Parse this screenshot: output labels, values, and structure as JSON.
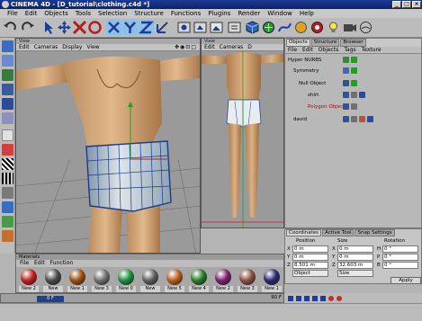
{
  "window": {
    "title": "CINEMA 4D - [D_tutorial\\clothing.c4d *]",
    "controls": [
      "_",
      "□",
      "×"
    ]
  },
  "menubar": [
    "File",
    "Edit",
    "Objects",
    "Tools",
    "Selection",
    "Structure",
    "Functions",
    "Plugins",
    "Render",
    "Window",
    "Help"
  ],
  "toolbar": {
    "icons": [
      "undo-icon",
      "redo-icon",
      "select-icon",
      "move-icon",
      "scale-icon",
      "rotate-icon",
      "x-axis-icon",
      "y-axis-icon",
      "z-axis-icon",
      "world-icon",
      "render-view-icon",
      "render-picture-icon",
      "cube-icon",
      "nurbs-icon",
      "deformer-icon",
      "scene-icon",
      "light-icon"
    ]
  },
  "viewports": [
    {
      "header": "View",
      "menu": [
        "Edit",
        "Cameras",
        "Display",
        "View"
      ]
    },
    {
      "header": "View",
      "menu": [
        "Edit",
        "Cameras",
        "D"
      ]
    }
  ],
  "object_manager": {
    "tabs": [
      "Objects",
      "Structure",
      "Browser"
    ],
    "active_tab": "Objects",
    "menu": [
      "File",
      "Edit",
      "Objects",
      "Tags",
      "Texture"
    ],
    "rows": [
      {
        "name": "Hyper NURBS",
        "color": "#000000"
      },
      {
        "name": "Symmetry",
        "color": "#000000"
      },
      {
        "name": "Null Object",
        "color": "#000000"
      },
      {
        "name": "shirt",
        "color": "#000000"
      },
      {
        "name": "Polygon Object",
        "color": "#c00000"
      },
      {
        "name": "david",
        "color": "#000000"
      }
    ]
  },
  "attributes": {
    "tabs": [
      "Coordinates",
      "Active Tool",
      "Snap Settings"
    ],
    "active_tab": "Coordinates",
    "columns": [
      "Position",
      "Size",
      "Rotation"
    ],
    "rows": [
      {
        "axis": "X",
        "pos": "0 m",
        "size_axis": "X",
        "size": "0 m",
        "rot_axis": "H",
        "rot": "0 °"
      },
      {
        "axis": "Y",
        "pos": "0 m",
        "size_axis": "Y",
        "size": "0 m",
        "rot_axis": "P",
        "rot": "0 °"
      },
      {
        "axis": "Z",
        "pos": "8.501 m",
        "size_axis": "Z",
        "size": "32.603 m",
        "rot_axis": "B",
        "rot": "0 °"
      }
    ],
    "mode_left": "Object",
    "mode_right": "Size",
    "apply_label": "Apply"
  },
  "material_manager": {
    "header": "Materials",
    "menu": [
      "File",
      "Edit",
      "Function"
    ],
    "materials": [
      {
        "name": "New 2",
        "color": "#c02020"
      },
      {
        "name": "New",
        "color": "#4a4a4a"
      },
      {
        "name": "New 1",
        "color": "#9a4f10"
      },
      {
        "name": "New 3",
        "color": "#707070"
      },
      {
        "name": "New 0",
        "color": "#1f8f3f"
      },
      {
        "name": "New",
        "color": "#606060"
      },
      {
        "name": "New 5",
        "color": "#b06020"
      },
      {
        "name": "New 4",
        "color": "#2b7a2b"
      },
      {
        "name": "New 2",
        "color": "#7a2070"
      },
      {
        "name": "New 3",
        "color": "#8a5040"
      },
      {
        "name": "New 1",
        "color": "#2a2a70"
      }
    ]
  },
  "timeline": {
    "frame": "0 F",
    "end": "90 F"
  }
}
